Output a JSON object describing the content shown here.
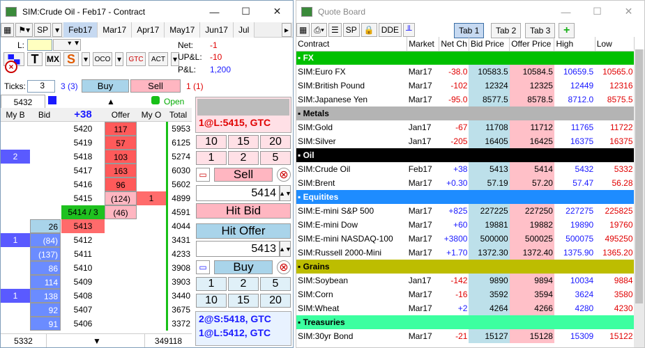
{
  "dom": {
    "title": "SIM:Crude Oil - Feb17 - Contract",
    "toolbar_sp": "SP",
    "months": [
      "Feb17",
      "Mar17",
      "Apr17",
      "May17",
      "Jun17",
      "Jul"
    ],
    "l_label": "L:",
    "net_label": "Net:",
    "net_value": "-1",
    "upl_label": "UP&L:",
    "upl_value": "-10",
    "pl_label": "P&L:",
    "pl_value": "1,200",
    "ticks_label": "Ticks:",
    "ticks_value": "3",
    "ticks_info": "3 (3)",
    "buy_label": "Buy",
    "sell_label": "Sell",
    "sell_info": "1 (1)",
    "price_box": "5432",
    "open_label": "Open",
    "col_myb": "My B",
    "col_bid": "Bid",
    "col_net": "+38",
    "col_offer": "Offer",
    "col_myo": "My O",
    "col_total": "Total",
    "rows": [
      {
        "myb": "",
        "bid": "",
        "price": "5420",
        "offer": "117",
        "myo": "",
        "total": "5953"
      },
      {
        "myb": "",
        "bid": "",
        "price": "5419",
        "offer": "57",
        "myo": "",
        "total": "6125"
      },
      {
        "myb": "2",
        "bid": "",
        "price": "5418",
        "offer": "103",
        "myo": "",
        "total": "5274"
      },
      {
        "myb": "",
        "bid": "",
        "price": "5417",
        "offer": "163",
        "myo": "",
        "total": "6030"
      },
      {
        "myb": "",
        "bid": "",
        "price": "5416",
        "offer": "96",
        "myo": "",
        "total": "5602"
      },
      {
        "myb": "",
        "bid": "",
        "price": "5415",
        "offer": "(124)",
        "myo": "1",
        "total": "4899"
      },
      {
        "myb": "",
        "bid": "",
        "price": "5414 / 3",
        "offer": "(46)",
        "myo": "",
        "total": "4591"
      },
      {
        "myb": "",
        "bid": "26",
        "price": "5413",
        "offer": "",
        "myo": "",
        "total": "4044"
      },
      {
        "myb": "1",
        "bid": "(84)",
        "price": "5412",
        "offer": "",
        "myo": "",
        "total": "3431"
      },
      {
        "myb": "",
        "bid": "(137)",
        "price": "5411",
        "offer": "",
        "myo": "",
        "total": "4233"
      },
      {
        "myb": "",
        "bid": "86",
        "price": "5410",
        "offer": "",
        "myo": "",
        "total": "3908"
      },
      {
        "myb": "",
        "bid": "114",
        "price": "5409",
        "offer": "",
        "myo": "",
        "total": "3903"
      },
      {
        "myb": "1",
        "bid": "138",
        "price": "5408",
        "offer": "",
        "myo": "",
        "total": "3440"
      },
      {
        "myb": "",
        "bid": "92",
        "price": "5407",
        "offer": "",
        "myo": "",
        "total": "3675"
      },
      {
        "myb": "",
        "bid": "91",
        "price": "5406",
        "offer": "",
        "myo": "",
        "total": "3372"
      }
    ],
    "bottom_left": "5332",
    "bottom_right": "349118",
    "order_top": "1@L:5415, GTC",
    "qty": [
      "10",
      "15",
      "20",
      "1",
      "2",
      "5"
    ],
    "sell_btn": "Sell",
    "sell_price": "5414",
    "hit_bid": "Hit Bid",
    "hit_offer": "Hit Offer",
    "buy_price": "5413",
    "buy_btn": "Buy",
    "order_bottom": [
      "2@S:5418, GTC",
      "1@L:5412, GTC"
    ]
  },
  "qb": {
    "title": "Quote Board",
    "toolbar_sp": "SP",
    "toolbar_dde": "DDE",
    "tabs": [
      "Tab 1",
      "Tab 2",
      "Tab 3"
    ],
    "headers": [
      "Contract",
      "Market",
      "Net Ch",
      "Bid Price",
      "Offer Price",
      "High",
      "Low"
    ],
    "groups": [
      {
        "name": "FX",
        "color": "#00c000",
        "rows": [
          [
            "SIM:Euro FX",
            "Mar17",
            "-38.0",
            "10583.5",
            "10584.5",
            "10659.5",
            "10565.0"
          ],
          [
            "SIM:British Pound",
            "Mar17",
            "-102",
            "12324",
            "12325",
            "12449",
            "12316"
          ],
          [
            "SIM:Japanese Yen",
            "Mar17",
            "-95.0",
            "8577.5",
            "8578.5",
            "8712.0",
            "8575.5"
          ]
        ]
      },
      {
        "name": "Metals",
        "color": "#b4b4b4",
        "rows": [
          [
            "SIM:Gold",
            "Jan17",
            "-67",
            "11708",
            "11712",
            "11765",
            "11722"
          ],
          [
            "SIM:Silver",
            "Jan17",
            "-205",
            "16405",
            "16425",
            "16375",
            "16375"
          ]
        ]
      },
      {
        "name": "Oil",
        "color": "#000000",
        "rows": [
          [
            "SIM:Crude Oil",
            "Feb17",
            "+38",
            "5413",
            "5414",
            "5432",
            "5332"
          ],
          [
            "SIM:Brent",
            "Mar17",
            "+0.30",
            "57.19",
            "57.20",
            "57.47",
            "56.28"
          ]
        ]
      },
      {
        "name": "Equitites",
        "color": "#1e8cff",
        "rows": [
          [
            "SIM:E-mini S&P 500",
            "Mar17",
            "+825",
            "227225",
            "227250",
            "227275",
            "225825"
          ],
          [
            "SIM:E-mini Dow",
            "Mar17",
            "+60",
            "19881",
            "19882",
            "19890",
            "19760"
          ],
          [
            "SIM:E-mini NASDAQ-100",
            "Mar17",
            "+3800",
            "500000",
            "500025",
            "500075",
            "495250"
          ],
          [
            "SIM:Russell 2000-Mini",
            "Mar17",
            "+1.70",
            "1372.30",
            "1372.40",
            "1375.90",
            "1365.20"
          ]
        ]
      },
      {
        "name": "Grains",
        "color": "#bdbd00",
        "rows": [
          [
            "SIM:Soybean",
            "Jan17",
            "-142",
            "9890",
            "9894",
            "10034",
            "9884"
          ],
          [
            "SIM:Corn",
            "Mar17",
            "-16",
            "3592",
            "3594",
            "3624",
            "3580"
          ],
          [
            "SIM:Wheat",
            "Mar17",
            "+2",
            "4264",
            "4266",
            "4280",
            "4230"
          ]
        ]
      },
      {
        "name": "Treasuries",
        "color": "#3cffa0",
        "rows": [
          [
            "SIM:30yr Bond",
            "Mar17",
            "-21",
            "15127",
            "15128",
            "15309",
            "15122"
          ]
        ]
      }
    ]
  }
}
